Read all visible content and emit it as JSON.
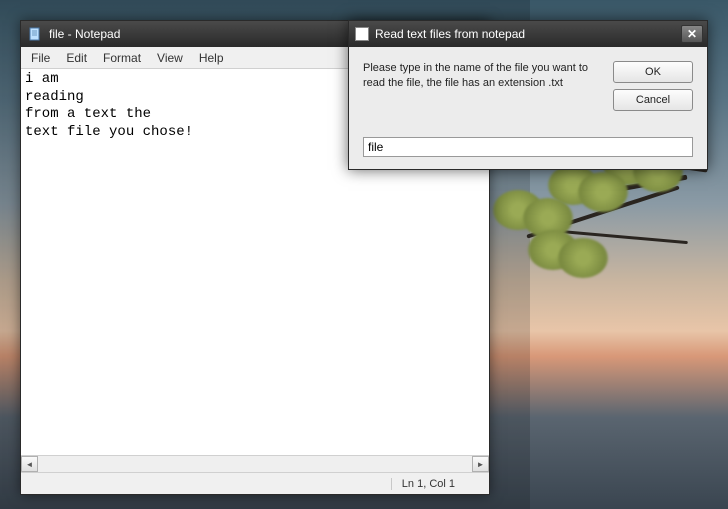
{
  "notepad": {
    "title": "file - Notepad",
    "menu": {
      "file": "File",
      "edit": "Edit",
      "format": "Format",
      "view": "View",
      "help": "Help"
    },
    "content": "i am\nreading\nfrom a text the\ntext file you chose!",
    "status": "Ln 1, Col 1"
  },
  "dialog": {
    "title": "Read text files from notepad",
    "message": "Please type in the name of the file you want to read the file, the file has an extension .txt",
    "ok_label": "OK",
    "cancel_label": "Cancel",
    "input_value": "file"
  }
}
